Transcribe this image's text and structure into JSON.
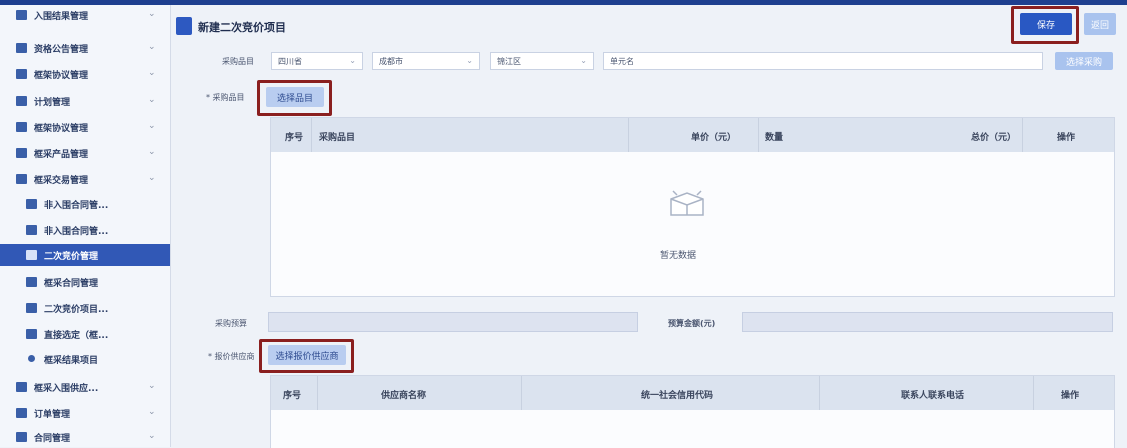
{
  "sidebar": {
    "items": [
      {
        "label": "入围结果管理",
        "arrow": "⌄"
      },
      {
        "label": "资格公告管理",
        "arrow": "⌄"
      },
      {
        "label": "框架协议管理",
        "arrow": "⌄"
      },
      {
        "label": "计划管理",
        "arrow": "⌄"
      },
      {
        "label": "框架协议管理",
        "arrow": "⌄"
      },
      {
        "label": "框采产品管理",
        "arrow": "⌄"
      },
      {
        "label": "框采交易管理",
        "arrow": "⌄"
      },
      {
        "label": "非入围合同管...",
        "arrow": ""
      },
      {
        "label": "非入围合同管...",
        "arrow": ""
      },
      {
        "label": "二次竞价管理",
        "arrow": ""
      },
      {
        "label": "框采合同管理",
        "arrow": ""
      },
      {
        "label": "二次竞价项目...",
        "arrow": ""
      },
      {
        "label": "直接选定（框...",
        "arrow": ""
      },
      {
        "label": "框采结果项目",
        "arrow": ""
      },
      {
        "label": "框采入围供应...",
        "arrow": "⌄"
      },
      {
        "label": "订单管理",
        "arrow": "⌄"
      },
      {
        "label": "合同管理",
        "arrow": "⌄"
      }
    ]
  },
  "page": {
    "title": "新建二次竞价项目",
    "save_label": "保存",
    "back_label": "返回"
  },
  "filters": {
    "label": "采购品目",
    "selects": [
      "四川省",
      "成都市",
      "锦江区",
      "单元名"
    ],
    "chev": "⌄",
    "action_label": "选择采购"
  },
  "section1": {
    "label": "* 采购品目",
    "button_label": "选择品目",
    "headers": [
      "序号",
      "采购品目",
      "单价（元）",
      "数量",
      "总价（元）",
      "操作"
    ],
    "empty_text": "暂无数据"
  },
  "budget": {
    "label": "采购预算",
    "amount_label": "预算金额(元)"
  },
  "section2": {
    "label": "* 报价供应商",
    "button_label": "选择报价供应商",
    "headers": [
      "序号",
      "供应商名称",
      "统一社会信用代码",
      "联系人联系电话",
      "操作"
    ]
  },
  "colors": {
    "accent": "#2958c3",
    "highlight": "#8a1f1f",
    "sidebar_active": "#3158b6"
  }
}
